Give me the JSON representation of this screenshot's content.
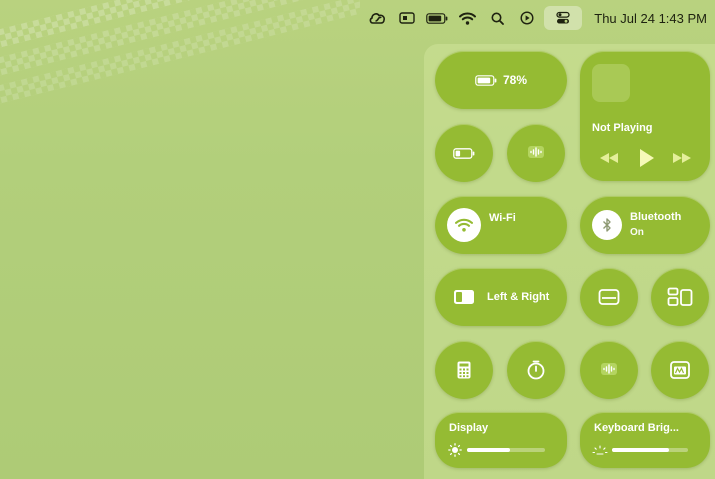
{
  "menubar": {
    "icons": [
      "creative-cloud-icon",
      "card-icon",
      "battery-icon",
      "wifi-icon",
      "search-icon",
      "play-circle-icon",
      "control-center-icon"
    ],
    "clock": "Thu Jul 24  1:43 PM"
  },
  "control_center": {
    "battery": {
      "label": "78%",
      "level": 0.78
    },
    "media": {
      "title": "Not Playing",
      "controls": [
        "rewind-icon",
        "play-icon",
        "fast-forward-icon"
      ]
    },
    "wifi": {
      "label": "Wi-Fi",
      "status": ""
    },
    "bluetooth": {
      "label": "Bluetooth",
      "status": "On"
    },
    "window_tile": {
      "label": "Left & Right"
    },
    "display": {
      "label": "Display",
      "level": 0.55
    },
    "keyboard": {
      "label": "Keyboard Brig...",
      "level": 0.75
    },
    "small_tiles": [
      "low-power-icon",
      "audio-icon",
      "screen-mirror-icon",
      "stage-manager-icon",
      "calculator-icon",
      "timer-icon",
      "hearing-icon",
      "screen-recording-icon"
    ]
  },
  "colors": {
    "tile": "#95bb33",
    "background": "#b2cf7b",
    "text": "#ffffff"
  }
}
